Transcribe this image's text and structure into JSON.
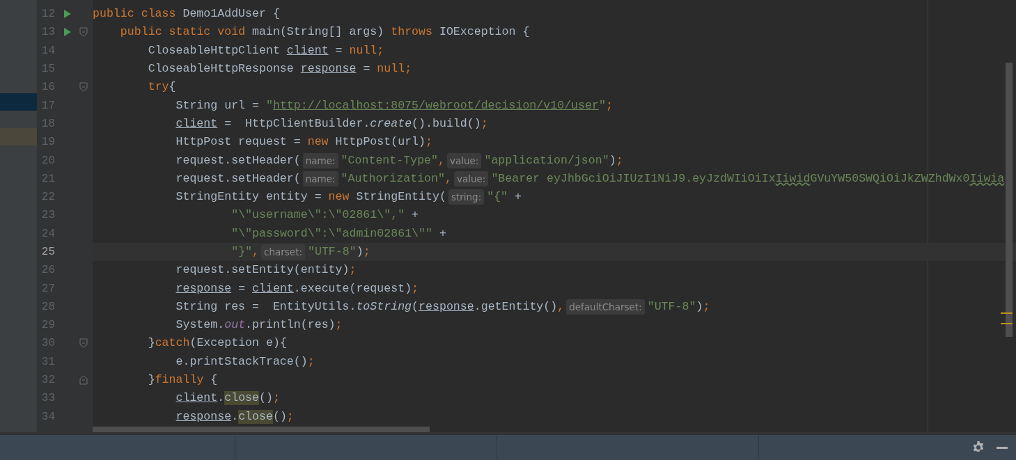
{
  "project_panel": {
    "rows": [
      {
        "kind": "selected"
      },
      {
        "kind": "match"
      }
    ]
  },
  "editor": {
    "lines": [
      {
        "number": "12",
        "run": true,
        "fold_start": false,
        "fold_end": false,
        "current": false,
        "tokens": [
          {
            "text": "public class ",
            "kind": "kw"
          },
          {
            "text": "Demo1AddUser {",
            "kind": "plain"
          }
        ]
      },
      {
        "number": "13",
        "run": true,
        "fold_start": true,
        "fold_end": false,
        "current": false,
        "tokens": [
          {
            "text": "    public static void ",
            "kind": "kw"
          },
          {
            "text": "main(String[] args) ",
            "kind": "plain"
          },
          {
            "text": "throws ",
            "kind": "kw"
          },
          {
            "text": "IOException {",
            "kind": "plain"
          }
        ]
      },
      {
        "number": "14",
        "run": false,
        "fold_start": false,
        "fold_end": false,
        "current": false,
        "tokens": [
          {
            "text": "        CloseableHttpClient ",
            "kind": "plain"
          },
          {
            "text": "client",
            "kind": "var"
          },
          {
            "text": " = ",
            "kind": "plain"
          },
          {
            "text": "null",
            "kind": "kw"
          },
          {
            "text": ";",
            "kind": "kw"
          }
        ]
      },
      {
        "number": "15",
        "run": false,
        "fold_start": false,
        "fold_end": false,
        "current": false,
        "tokens": [
          {
            "text": "        CloseableHttpResponse ",
            "kind": "plain"
          },
          {
            "text": "response",
            "kind": "var"
          },
          {
            "text": " = ",
            "kind": "plain"
          },
          {
            "text": "null",
            "kind": "kw"
          },
          {
            "text": ";",
            "kind": "kw"
          }
        ]
      },
      {
        "number": "16",
        "run": false,
        "fold_start": true,
        "fold_end": false,
        "current": false,
        "tokens": [
          {
            "text": "        try",
            "kind": "kw"
          },
          {
            "text": "{",
            "kind": "plain"
          }
        ]
      },
      {
        "number": "17",
        "run": false,
        "fold_start": false,
        "fold_end": false,
        "current": false,
        "tokens": [
          {
            "text": "            String url = ",
            "kind": "plain"
          },
          {
            "text": "\"",
            "kind": "str"
          },
          {
            "text": "http://localhost:8075/webroot/decision/v10/user",
            "kind": "link"
          },
          {
            "text": "\"",
            "kind": "str"
          },
          {
            "text": ";",
            "kind": "kw"
          }
        ]
      },
      {
        "number": "18",
        "run": false,
        "fold_start": false,
        "fold_end": false,
        "current": false,
        "tokens": [
          {
            "text": "            client",
            "kind": "var"
          },
          {
            "text": " =  HttpClientBuilder.",
            "kind": "plain"
          },
          {
            "text": "create",
            "kind": "static"
          },
          {
            "text": "().build()",
            "kind": "plain"
          },
          {
            "text": ";",
            "kind": "kw"
          }
        ]
      },
      {
        "number": "19",
        "run": false,
        "fold_start": false,
        "fold_end": false,
        "current": false,
        "tokens": [
          {
            "text": "            HttpPost request = ",
            "kind": "plain"
          },
          {
            "text": "new ",
            "kind": "kw"
          },
          {
            "text": "HttpPost(url)",
            "kind": "plain"
          },
          {
            "text": ";",
            "kind": "kw"
          }
        ]
      },
      {
        "number": "20",
        "run": false,
        "fold_start": false,
        "fold_end": false,
        "current": false,
        "tokens": [
          {
            "text": "            request.setHeader(",
            "kind": "plain"
          },
          {
            "text": "name:",
            "kind": "hint"
          },
          {
            "text": "\"Content-Type\"",
            "kind": "str"
          },
          {
            "text": ",",
            "kind": "kw"
          },
          {
            "text": "value:",
            "kind": "hint"
          },
          {
            "text": "\"application/json\"",
            "kind": "str"
          },
          {
            "text": ")",
            "kind": "plain"
          },
          {
            "text": ";",
            "kind": "kw"
          }
        ]
      },
      {
        "number": "21",
        "run": false,
        "fold_start": false,
        "fold_end": false,
        "current": false,
        "tokens": [
          {
            "text": "            request.setHeader(",
            "kind": "plain"
          },
          {
            "text": "name:",
            "kind": "hint"
          },
          {
            "text": "\"Authorization\"",
            "kind": "str"
          },
          {
            "text": ",",
            "kind": "kw"
          },
          {
            "text": "value:",
            "kind": "hint"
          },
          {
            "text": "\"Bearer eyJhbGciOiJIUzI1NiJ9.eyJzdWIiOiIx",
            "kind": "str"
          },
          {
            "text": "Iiwid",
            "kind": "typo"
          },
          {
            "text": "GVuYW50SWQiOiJkZWZhdWx0",
            "kind": "str"
          },
          {
            "text": "Iiwia",
            "kind": "typo"
          }
        ]
      },
      {
        "number": "22",
        "run": false,
        "fold_start": false,
        "fold_end": false,
        "current": false,
        "tokens": [
          {
            "text": "            StringEntity entity = ",
            "kind": "plain"
          },
          {
            "text": "new ",
            "kind": "kw"
          },
          {
            "text": "StringEntity(",
            "kind": "plain"
          },
          {
            "text": "string:",
            "kind": "hint"
          },
          {
            "text": "\"{\"",
            "kind": "str"
          },
          {
            "text": " +",
            "kind": "plain"
          }
        ]
      },
      {
        "number": "23",
        "run": false,
        "fold_start": false,
        "fold_end": false,
        "current": false,
        "tokens": [
          {
            "text": "                    \"\\\"username\\\":\\\"02861\\\",\"",
            "kind": "str"
          },
          {
            "text": " +",
            "kind": "plain"
          }
        ]
      },
      {
        "number": "24",
        "run": false,
        "fold_start": false,
        "fold_end": false,
        "current": false,
        "tokens": [
          {
            "text": "                    \"\\\"password\\\":\\\"admin02861\\\"\"",
            "kind": "str"
          },
          {
            "text": " +",
            "kind": "plain"
          }
        ]
      },
      {
        "number": "25",
        "run": false,
        "fold_start": false,
        "fold_end": false,
        "current": true,
        "tokens": [
          {
            "text": "                    \"}\"",
            "kind": "str"
          },
          {
            "text": ",",
            "kind": "kw"
          },
          {
            "text": "charset:",
            "kind": "hint"
          },
          {
            "text": "\"UTF-8\"",
            "kind": "str"
          },
          {
            "text": ")",
            "kind": "plain"
          },
          {
            "text": ";",
            "kind": "kw"
          }
        ]
      },
      {
        "number": "26",
        "run": false,
        "fold_start": false,
        "fold_end": false,
        "current": false,
        "tokens": [
          {
            "text": "            request.setEntity(entity)",
            "kind": "plain"
          },
          {
            "text": ";",
            "kind": "kw"
          }
        ]
      },
      {
        "number": "27",
        "run": false,
        "fold_start": false,
        "fold_end": false,
        "current": false,
        "tokens": [
          {
            "text": "            response",
            "kind": "var"
          },
          {
            "text": " = ",
            "kind": "plain"
          },
          {
            "text": "client",
            "kind": "var"
          },
          {
            "text": ".execute(request)",
            "kind": "plain"
          },
          {
            "text": ";",
            "kind": "kw"
          }
        ]
      },
      {
        "number": "28",
        "run": false,
        "fold_start": false,
        "fold_end": false,
        "current": false,
        "tokens": [
          {
            "text": "            String res =  EntityUtils.",
            "kind": "plain"
          },
          {
            "text": "toString",
            "kind": "static"
          },
          {
            "text": "(",
            "kind": "plain"
          },
          {
            "text": "response",
            "kind": "var"
          },
          {
            "text": ".getEntity()",
            "kind": "plain"
          },
          {
            "text": ",",
            "kind": "kw"
          },
          {
            "text": "defaultCharset:",
            "kind": "hint"
          },
          {
            "text": "\"UTF-8\"",
            "kind": "str"
          },
          {
            "text": ")",
            "kind": "plain"
          },
          {
            "text": ";",
            "kind": "kw"
          }
        ]
      },
      {
        "number": "29",
        "run": false,
        "fold_start": false,
        "fold_end": false,
        "current": false,
        "tokens": [
          {
            "text": "            System.",
            "kind": "plain"
          },
          {
            "text": "out",
            "kind": "field"
          },
          {
            "text": ".println(res)",
            "kind": "plain"
          },
          {
            "text": ";",
            "kind": "kw"
          }
        ]
      },
      {
        "number": "30",
        "run": false,
        "fold_start": true,
        "fold_end": false,
        "current": false,
        "tokens": [
          {
            "text": "        }",
            "kind": "plain"
          },
          {
            "text": "catch",
            "kind": "kw"
          },
          {
            "text": "(Exception e){",
            "kind": "plain"
          }
        ]
      },
      {
        "number": "31",
        "run": false,
        "fold_start": false,
        "fold_end": false,
        "current": false,
        "tokens": [
          {
            "text": "            e.printStackTrace()",
            "kind": "plain"
          },
          {
            "text": ";",
            "kind": "kw"
          }
        ]
      },
      {
        "number": "32",
        "run": false,
        "fold_start": false,
        "fold_end": true,
        "current": false,
        "tokens": [
          {
            "text": "        }",
            "kind": "plain"
          },
          {
            "text": "finally ",
            "kind": "kw"
          },
          {
            "text": "{",
            "kind": "plain"
          }
        ]
      },
      {
        "number": "33",
        "run": false,
        "fold_start": false,
        "fold_end": false,
        "current": false,
        "tokens": [
          {
            "text": "            client",
            "kind": "var"
          },
          {
            "text": ".",
            "kind": "plain"
          },
          {
            "text": "close",
            "kind": "usage"
          },
          {
            "text": "()",
            "kind": "plain"
          },
          {
            "text": ";",
            "kind": "kw"
          }
        ]
      },
      {
        "number": "34",
        "run": false,
        "fold_start": false,
        "fold_end": false,
        "current": false,
        "tokens": [
          {
            "text": "            response",
            "kind": "var"
          },
          {
            "text": ".",
            "kind": "plain"
          },
          {
            "text": "close",
            "kind": "usage"
          },
          {
            "text": "()",
            "kind": "plain"
          },
          {
            "text": ";",
            "kind": "kw"
          }
        ]
      }
    ]
  }
}
